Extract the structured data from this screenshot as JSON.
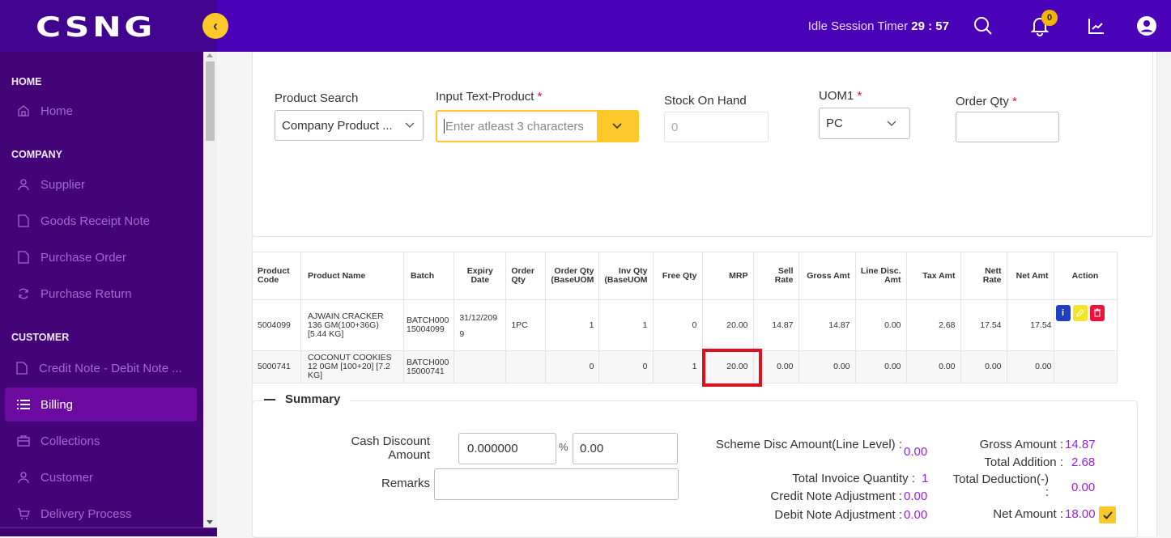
{
  "app": {
    "logo": "CSNG"
  },
  "header": {
    "idle_label": "Idle Session Timer ",
    "idle_time": "29 : 57",
    "notification_count": "0",
    "colors": {
      "topbar": "#4a02b8",
      "accent": "#fcc82a"
    }
  },
  "sidebar": {
    "sections": [
      {
        "title": "HOME",
        "items": [
          {
            "label": "Home",
            "icon": "home-icon"
          }
        ]
      },
      {
        "title": "COMPANY",
        "items": [
          {
            "label": "Supplier",
            "icon": "user-icon"
          },
          {
            "label": "Goods Receipt Note",
            "icon": "file-icon"
          },
          {
            "label": "Purchase Order",
            "icon": "file-icon"
          },
          {
            "label": "Purchase Return",
            "icon": "refresh-icon"
          }
        ]
      },
      {
        "title": "CUSTOMER",
        "items": [
          {
            "label": "Credit Note - Debit Note ...",
            "icon": "file-icon"
          },
          {
            "label": "Billing",
            "icon": "list-icon",
            "active": true
          },
          {
            "label": "Collections",
            "icon": "briefcase-icon"
          },
          {
            "label": "Customer",
            "icon": "user-icon"
          },
          {
            "label": "Delivery Process",
            "icon": "cart-icon"
          }
        ]
      }
    ]
  },
  "form": {
    "product_search": {
      "label": "Product Search",
      "value": "Company Product ..."
    },
    "input_text_product": {
      "label": "Input Text-Product",
      "required": "*",
      "placeholder": "Enter atleast 3 characters"
    },
    "stock_on_hand": {
      "label": "Stock On Hand",
      "value": "0"
    },
    "uom1": {
      "label": "UOM1",
      "required": "*",
      "value": "PC"
    },
    "order_qty": {
      "label": "Order Qty",
      "required": "*",
      "value": ""
    }
  },
  "table": {
    "headers": [
      "Product Code",
      "Product Name",
      "Batch",
      "Expiry Date",
      "Order Qty",
      "Order Qty (BaseUOM",
      "Inv Qty (BaseUOM",
      "Free Qty",
      "MRP",
      "Sell Rate",
      "Gross Amt",
      "Line Disc. Amt",
      "Tax Amt",
      "Nett Rate",
      "Net Amt",
      "Action"
    ],
    "rows": [
      {
        "product_code": "5004099",
        "product_name": "AJWAIN CRACKER 136 GM(100+36G) [5.44 KG]",
        "batch": "BATCH000 15004099",
        "expiry_date": "31/12/209 9",
        "order_qty": "1PC",
        "order_qty_base": "1",
        "inv_qty_base": "1",
        "free_qty": "0",
        "mrp": "20.00",
        "sell_rate": "14.87",
        "gross_amt": "14.87",
        "line_disc_amt": "0.00",
        "tax_amt": "2.68",
        "nett_rate": "17.54",
        "net_amt": "17.54",
        "actions": [
          "info",
          "edit",
          "delete"
        ]
      },
      {
        "product_code": "5000741",
        "product_name": "COCONUT COOKIES 12 0GM [100+20] [7.2 KG]",
        "batch": "BATCH000 15000741",
        "expiry_date": "",
        "order_qty": "",
        "order_qty_base": "0",
        "inv_qty_base": "0",
        "free_qty": "1",
        "mrp": "20.00",
        "sell_rate": "0.00",
        "gross_amt": "0.00",
        "line_disc_amt": "0.00",
        "tax_amt": "0.00",
        "nett_rate": "0.00",
        "net_amt": "0.00",
        "actions": []
      }
    ],
    "action_colors": {
      "info": "#1f3fbf",
      "edit": "#f5e52a",
      "delete": "#f0103a"
    }
  },
  "summary": {
    "title": "Summary",
    "cash_discount_label": "Cash Discount Amount",
    "cash_discount_pct": "0.000000",
    "pct_symbol": "%",
    "cash_discount_amt": "0.00",
    "remarks_label": "Remarks",
    "remarks_value": "",
    "scheme_disc_label": "Scheme Disc Amount(Line Level) :",
    "scheme_disc_value": "0.00",
    "total_invoice_qty_label": "Total Invoice Quantity :",
    "total_invoice_qty_value": "1",
    "credit_note_adj_label": "Credit Note Adjustment :",
    "credit_note_adj_value": "0.00",
    "debit_note_adj_label": "Debit Note Adjustment :",
    "debit_note_adj_value": "0.00",
    "gross_amount_label": "Gross Amount :",
    "gross_amount_value": "14.87",
    "total_addition_label": "Total Addition :",
    "total_addition_value": "2.68",
    "total_deduction_label": "Total Deduction(-) :",
    "total_deduction_value": "0.00",
    "net_amount_label": "Net Amount :",
    "net_amount_value": "18.00"
  }
}
